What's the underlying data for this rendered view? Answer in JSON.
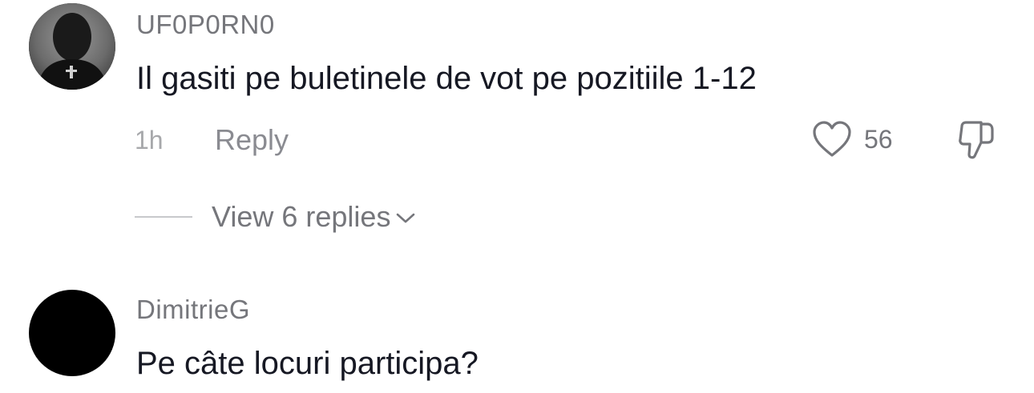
{
  "comments": [
    {
      "username": "UF0P0RN0",
      "text": "Il gasiti pe buletinele de vot pe pozitiile 1-12",
      "time": "1h",
      "reply_label": "Reply",
      "like_count": "56",
      "view_replies_label": "View 6 replies"
    },
    {
      "username": "DimitrieG",
      "text": "Pe câte locuri participa?"
    }
  ],
  "icons": {
    "like": "heart-icon",
    "dislike": "thumbs-down-icon",
    "expand": "chevron-down-icon"
  },
  "colors": {
    "text_primary": "#161823",
    "text_secondary": "#75767b",
    "text_tertiary": "#a7a8ab"
  }
}
